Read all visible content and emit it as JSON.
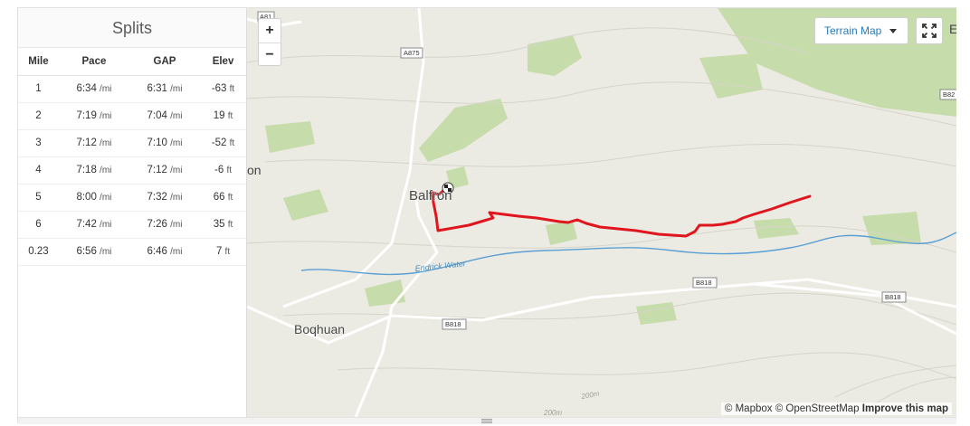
{
  "splits": {
    "title": "Splits",
    "columns": [
      "Mile",
      "Pace",
      "GAP",
      "Elev"
    ],
    "rows": [
      {
        "mile": "1",
        "pace": "6:34",
        "pace_unit": "/mi",
        "gap": "6:31",
        "gap_unit": "/mi",
        "elev": "-63",
        "elev_unit": "ft"
      },
      {
        "mile": "2",
        "pace": "7:19",
        "pace_unit": "/mi",
        "gap": "7:04",
        "gap_unit": "/mi",
        "elev": "19",
        "elev_unit": "ft"
      },
      {
        "mile": "3",
        "pace": "7:12",
        "pace_unit": "/mi",
        "gap": "7:10",
        "gap_unit": "/mi",
        "elev": "-52",
        "elev_unit": "ft"
      },
      {
        "mile": "4",
        "pace": "7:18",
        "pace_unit": "/mi",
        "gap": "7:12",
        "gap_unit": "/mi",
        "elev": "-6",
        "elev_unit": "ft"
      },
      {
        "mile": "5",
        "pace": "8:00",
        "pace_unit": "/mi",
        "gap": "7:32",
        "gap_unit": "/mi",
        "elev": "66",
        "elev_unit": "ft"
      },
      {
        "mile": "6",
        "pace": "7:42",
        "pace_unit": "/mi",
        "gap": "7:26",
        "gap_unit": "/mi",
        "elev": "35",
        "elev_unit": "ft"
      },
      {
        "mile": "0.23",
        "pace": "6:56",
        "pace_unit": "/mi",
        "gap": "6:46",
        "gap_unit": "/mi",
        "elev": "7",
        "elev_unit": "ft"
      }
    ]
  },
  "map": {
    "zoom_in": "+",
    "zoom_out": "−",
    "terrain_label": "Terrain Map",
    "labels": {
      "a81": "A81",
      "a875": "A875",
      "b82": "B82",
      "b818_a": "B818",
      "b818_b": "B818",
      "b818_c": "B818",
      "town_balfron": "Balfron",
      "town_boqhuan": "Boqhuan",
      "river": "Endrick Water",
      "contour": "200m",
      "contour2": "200m",
      "edge_left": "on",
      "edge_right": "E"
    },
    "attribution": {
      "mapbox": "© Mapbox",
      "osm": "© OpenStreetMap",
      "improve": "Improve this map"
    },
    "colors": {
      "route": "#e0161e",
      "river": "#5a9fd4",
      "green": "#c6dcab",
      "land": "#ecebe3"
    }
  }
}
